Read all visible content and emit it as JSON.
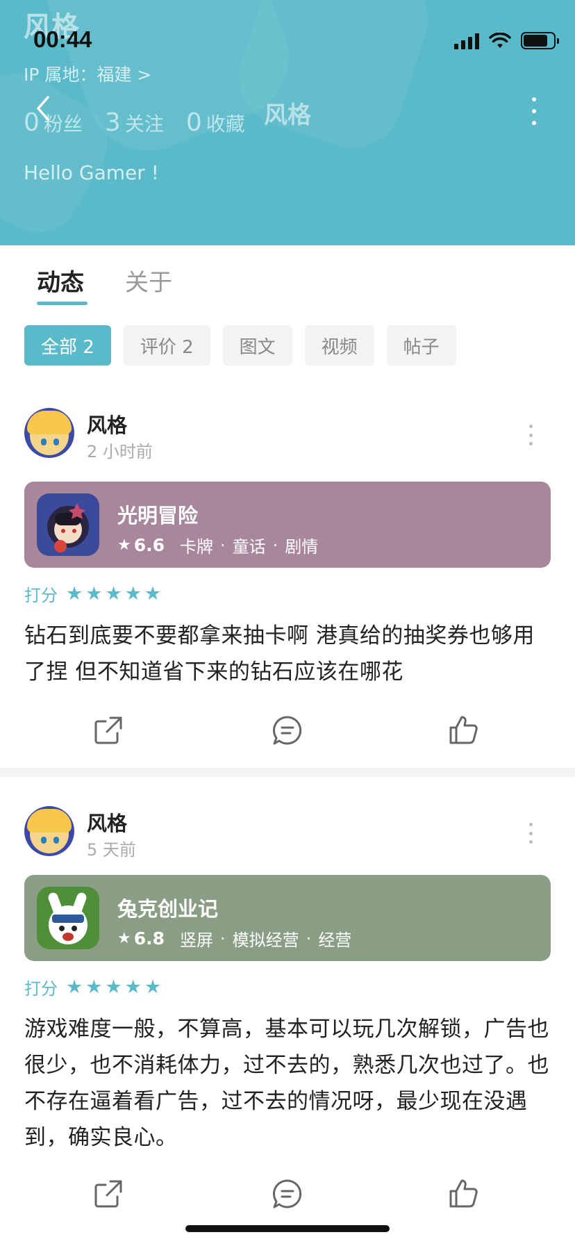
{
  "status_bar": {
    "time": "00:44"
  },
  "profile": {
    "name": "风格",
    "ip_location": "IP 属地：福建 >",
    "stats": [
      {
        "num": "0",
        "label": "粉丝"
      },
      {
        "num": "3",
        "label": "关注"
      },
      {
        "num": "0",
        "label": "收藏"
      }
    ],
    "bio": "Hello Gamer !"
  },
  "nav": {
    "title": "风格"
  },
  "tabs": [
    {
      "label": "动态",
      "active": true
    },
    {
      "label": "关于",
      "active": false
    }
  ],
  "filters": [
    {
      "label": "全部 2",
      "active": true
    },
    {
      "label": "评价 2",
      "active": false
    },
    {
      "label": "图文",
      "active": false
    },
    {
      "label": "视频",
      "active": false
    },
    {
      "label": "帖子",
      "active": false
    }
  ],
  "posts": [
    {
      "author": "风格",
      "time": "2 小时前",
      "game": {
        "name": "光明冒险",
        "score": "6.6",
        "tags": [
          "卡牌",
          "童话",
          "剧情"
        ],
        "bg_color": "#a8879d"
      },
      "rating_label": "打分",
      "stars": 5,
      "content": "钻石到底要不要都拿来抽卡啊 港真给的抽奖券也够用了捏 但不知道省下来的钻石应该在哪花"
    },
    {
      "author": "风格",
      "time": "5 天前",
      "game": {
        "name": "兔克创业记",
        "score": "6.8",
        "tags": [
          "竖屏",
          "模拟经营",
          "经营"
        ],
        "bg_color": "#8a9e86"
      },
      "rating_label": "打分",
      "stars": 5,
      "content": "游戏难度一般，不算高，基本可以玩几次解锁，广告也很少，也不消耗体力，过不去的，熟悉几次也过了。也不存在逼着看广告，过不去的情况呀，最少现在没遇到，确实良心。"
    }
  ],
  "colors": {
    "accent": "#5bbac9",
    "header_bg": "#5bbac9"
  }
}
